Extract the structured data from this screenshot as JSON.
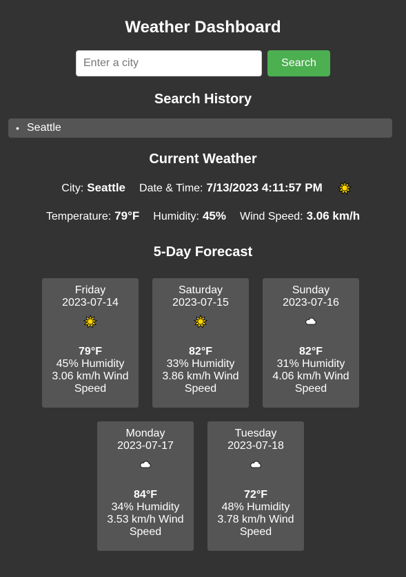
{
  "title": "Weather Dashboard",
  "search": {
    "placeholder": "Enter a city",
    "value": "",
    "button_label": "Search",
    "button_color": "#4caf50"
  },
  "history": {
    "heading": "Search History",
    "items": [
      "Seattle"
    ]
  },
  "current": {
    "heading": "Current Weather",
    "city_label": "City:",
    "city": "Seattle",
    "datetime_label": "Date & Time:",
    "datetime": "7/13/2023 4:11:57 PM",
    "icon": "sun-icon",
    "temperature_label": "Temperature:",
    "temperature": "79°F",
    "humidity_label": "Humidity:",
    "humidity": "45%",
    "wind_label": "Wind Speed:",
    "wind": "3.06 km/h"
  },
  "forecast": {
    "heading": "5-Day Forecast",
    "days": [
      {
        "day": "Friday",
        "date": "2023-07-14",
        "icon": "sun-icon",
        "temp": "79°F",
        "humidity": "45% Humidity",
        "wind": "3.06 km/h Wind Speed"
      },
      {
        "day": "Saturday",
        "date": "2023-07-15",
        "icon": "sun-icon",
        "temp": "82°F",
        "humidity": "33% Humidity",
        "wind": "3.86 km/h Wind Speed"
      },
      {
        "day": "Sunday",
        "date": "2023-07-16",
        "icon": "cloud-icon",
        "temp": "82°F",
        "humidity": "31% Humidity",
        "wind": "4.06 km/h Wind Speed"
      },
      {
        "day": "Monday",
        "date": "2023-07-17",
        "icon": "cloud-icon",
        "temp": "84°F",
        "humidity": "34% Humidity",
        "wind": "3.53 km/h Wind Speed"
      },
      {
        "day": "Tuesday",
        "date": "2023-07-18",
        "icon": "cloud-icon",
        "temp": "72°F",
        "humidity": "48% Humidity",
        "wind": "3.78 km/h Wind Speed"
      }
    ]
  },
  "colors": {
    "background": "#333333",
    "panel": "#555555",
    "text": "#ffffff",
    "sun": "#ffd700"
  }
}
